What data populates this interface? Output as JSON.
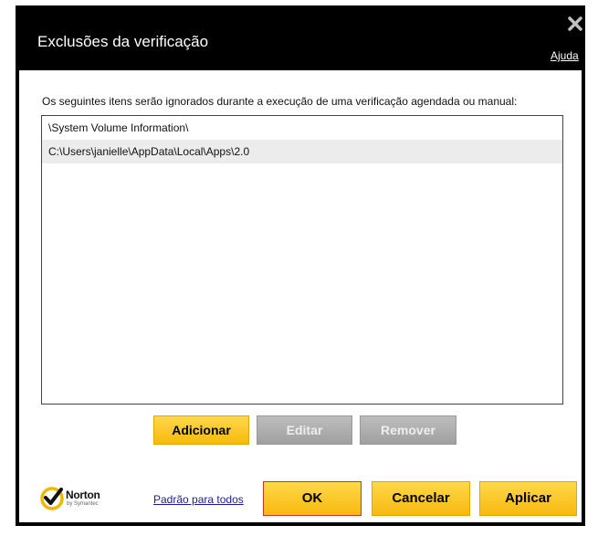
{
  "window": {
    "title": "Exclusões da verificação",
    "help_label": "Ajuda",
    "close_icon": "close-icon"
  },
  "main": {
    "description": "Os seguintes itens serão ignorados durante a execução de uma verificação agendada ou manual:",
    "exclusions": [
      "\\System Volume Information\\",
      "C:\\Users\\janielle\\AppData\\Local\\Apps\\2.0"
    ]
  },
  "list_actions": {
    "add_label": "Adicionar",
    "edit_label": "Editar",
    "remove_label": "Remover"
  },
  "footer": {
    "logo_text": "Norton",
    "logo_sub": "by Symantec",
    "defaults_link": "Padrão para todos",
    "ok_label": "OK",
    "cancel_label": "Cancelar",
    "apply_label": "Aplicar"
  },
  "colors": {
    "accent_yellow": "#f8b90e",
    "disabled_gray": "#a0a0a0",
    "titlebar": "#000000",
    "link_blue": "#1a1aa6"
  }
}
